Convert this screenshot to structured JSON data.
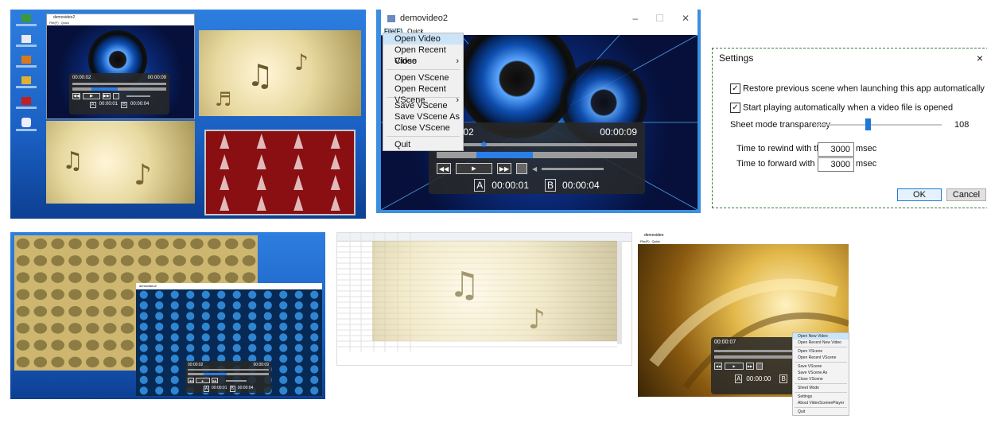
{
  "panel_desktop": {
    "icons": [
      "",
      "",
      "",
      "",
      "",
      ""
    ],
    "window_title": "demovideo2",
    "menu": [
      "File(F)",
      "Quick"
    ],
    "time_current": "00:00:02",
    "time_total": "00:00:09",
    "a_label": "A",
    "a_time": "00:00:01",
    "b_label": "B",
    "b_time": "00:00:04"
  },
  "panel_file_menu": {
    "window_title": "demovideo2",
    "menu_file": "File(F)",
    "menu_quick": "Quick",
    "file_items": [
      {
        "label": "Open Video",
        "submenu": false,
        "highlighted": true
      },
      {
        "label": "Open Recent Video",
        "submenu": true
      },
      {
        "label": "Close",
        "submenu": false
      },
      {
        "sep": true
      },
      {
        "label": "Open VScene",
        "submenu": false
      },
      {
        "label": "Open Recent VScene",
        "submenu": true
      },
      {
        "sep": true
      },
      {
        "label": "Save VScene",
        "submenu": false
      },
      {
        "label": "Save VScene As",
        "submenu": false
      },
      {
        "label": "Close VScene",
        "submenu": false
      },
      {
        "sep": true
      },
      {
        "label": "Quit",
        "submenu": false
      }
    ],
    "time_current": "00:00:02",
    "time_total": "00:00:09",
    "a_label": "A",
    "a_time": "00:00:01",
    "b_label": "B",
    "b_time": "00:00:04",
    "progress_fraction": 0.22
  },
  "settings": {
    "title": "Settings",
    "close": "×",
    "restore_label": "Restore previous scene when launching this app automatically",
    "restore_checked": true,
    "autoplay_label": "Start playing automatically when a video file is opened",
    "autoplay_checked": true,
    "transparency_label": "Sheet mode transparency",
    "transparency_value": "108",
    "transparency_fraction": 0.42,
    "rewind_label": "Time to rewind with the <<",
    "rewind_value": "3000",
    "forward_label": "Time to forward with the >>",
    "forward_value": "3000",
    "unit": "msec",
    "ok": "OK",
    "cancel": "Cancel"
  },
  "panel_tiled": {
    "time_current": "00:00:02",
    "time_total": "00:00:09",
    "a_label": "A",
    "a_time": "00:00:01",
    "b_label": "B",
    "b_time": "00:00:04"
  },
  "panel_gold": {
    "window_title": "demovideo",
    "menu": [
      "File(F)",
      "Quick"
    ],
    "time_current": "00:00:07",
    "a_label": "A",
    "a_time": "00:00:00",
    "b_label": "B",
    "context_items": [
      {
        "label": "Open New Video",
        "highlighted": true
      },
      {
        "label": "Open Recent New Video"
      },
      {
        "sep": true
      },
      {
        "label": "Open VScene"
      },
      {
        "label": "Open Recent VScene"
      },
      {
        "sep": true
      },
      {
        "label": "Save VScene"
      },
      {
        "label": "Save VScene As"
      },
      {
        "label": "Close VScene"
      },
      {
        "sep": true
      },
      {
        "label": "Sheet Mode"
      },
      {
        "sep": true
      },
      {
        "label": "Settings"
      },
      {
        "label": "About VideoSceneePlayer"
      },
      {
        "sep": true
      },
      {
        "label": "Quit"
      }
    ]
  },
  "colors": {
    "accent": "#2a7ee8",
    "desktop_blue": "#1a5fc2",
    "settings_border": "#3b7d3b"
  }
}
